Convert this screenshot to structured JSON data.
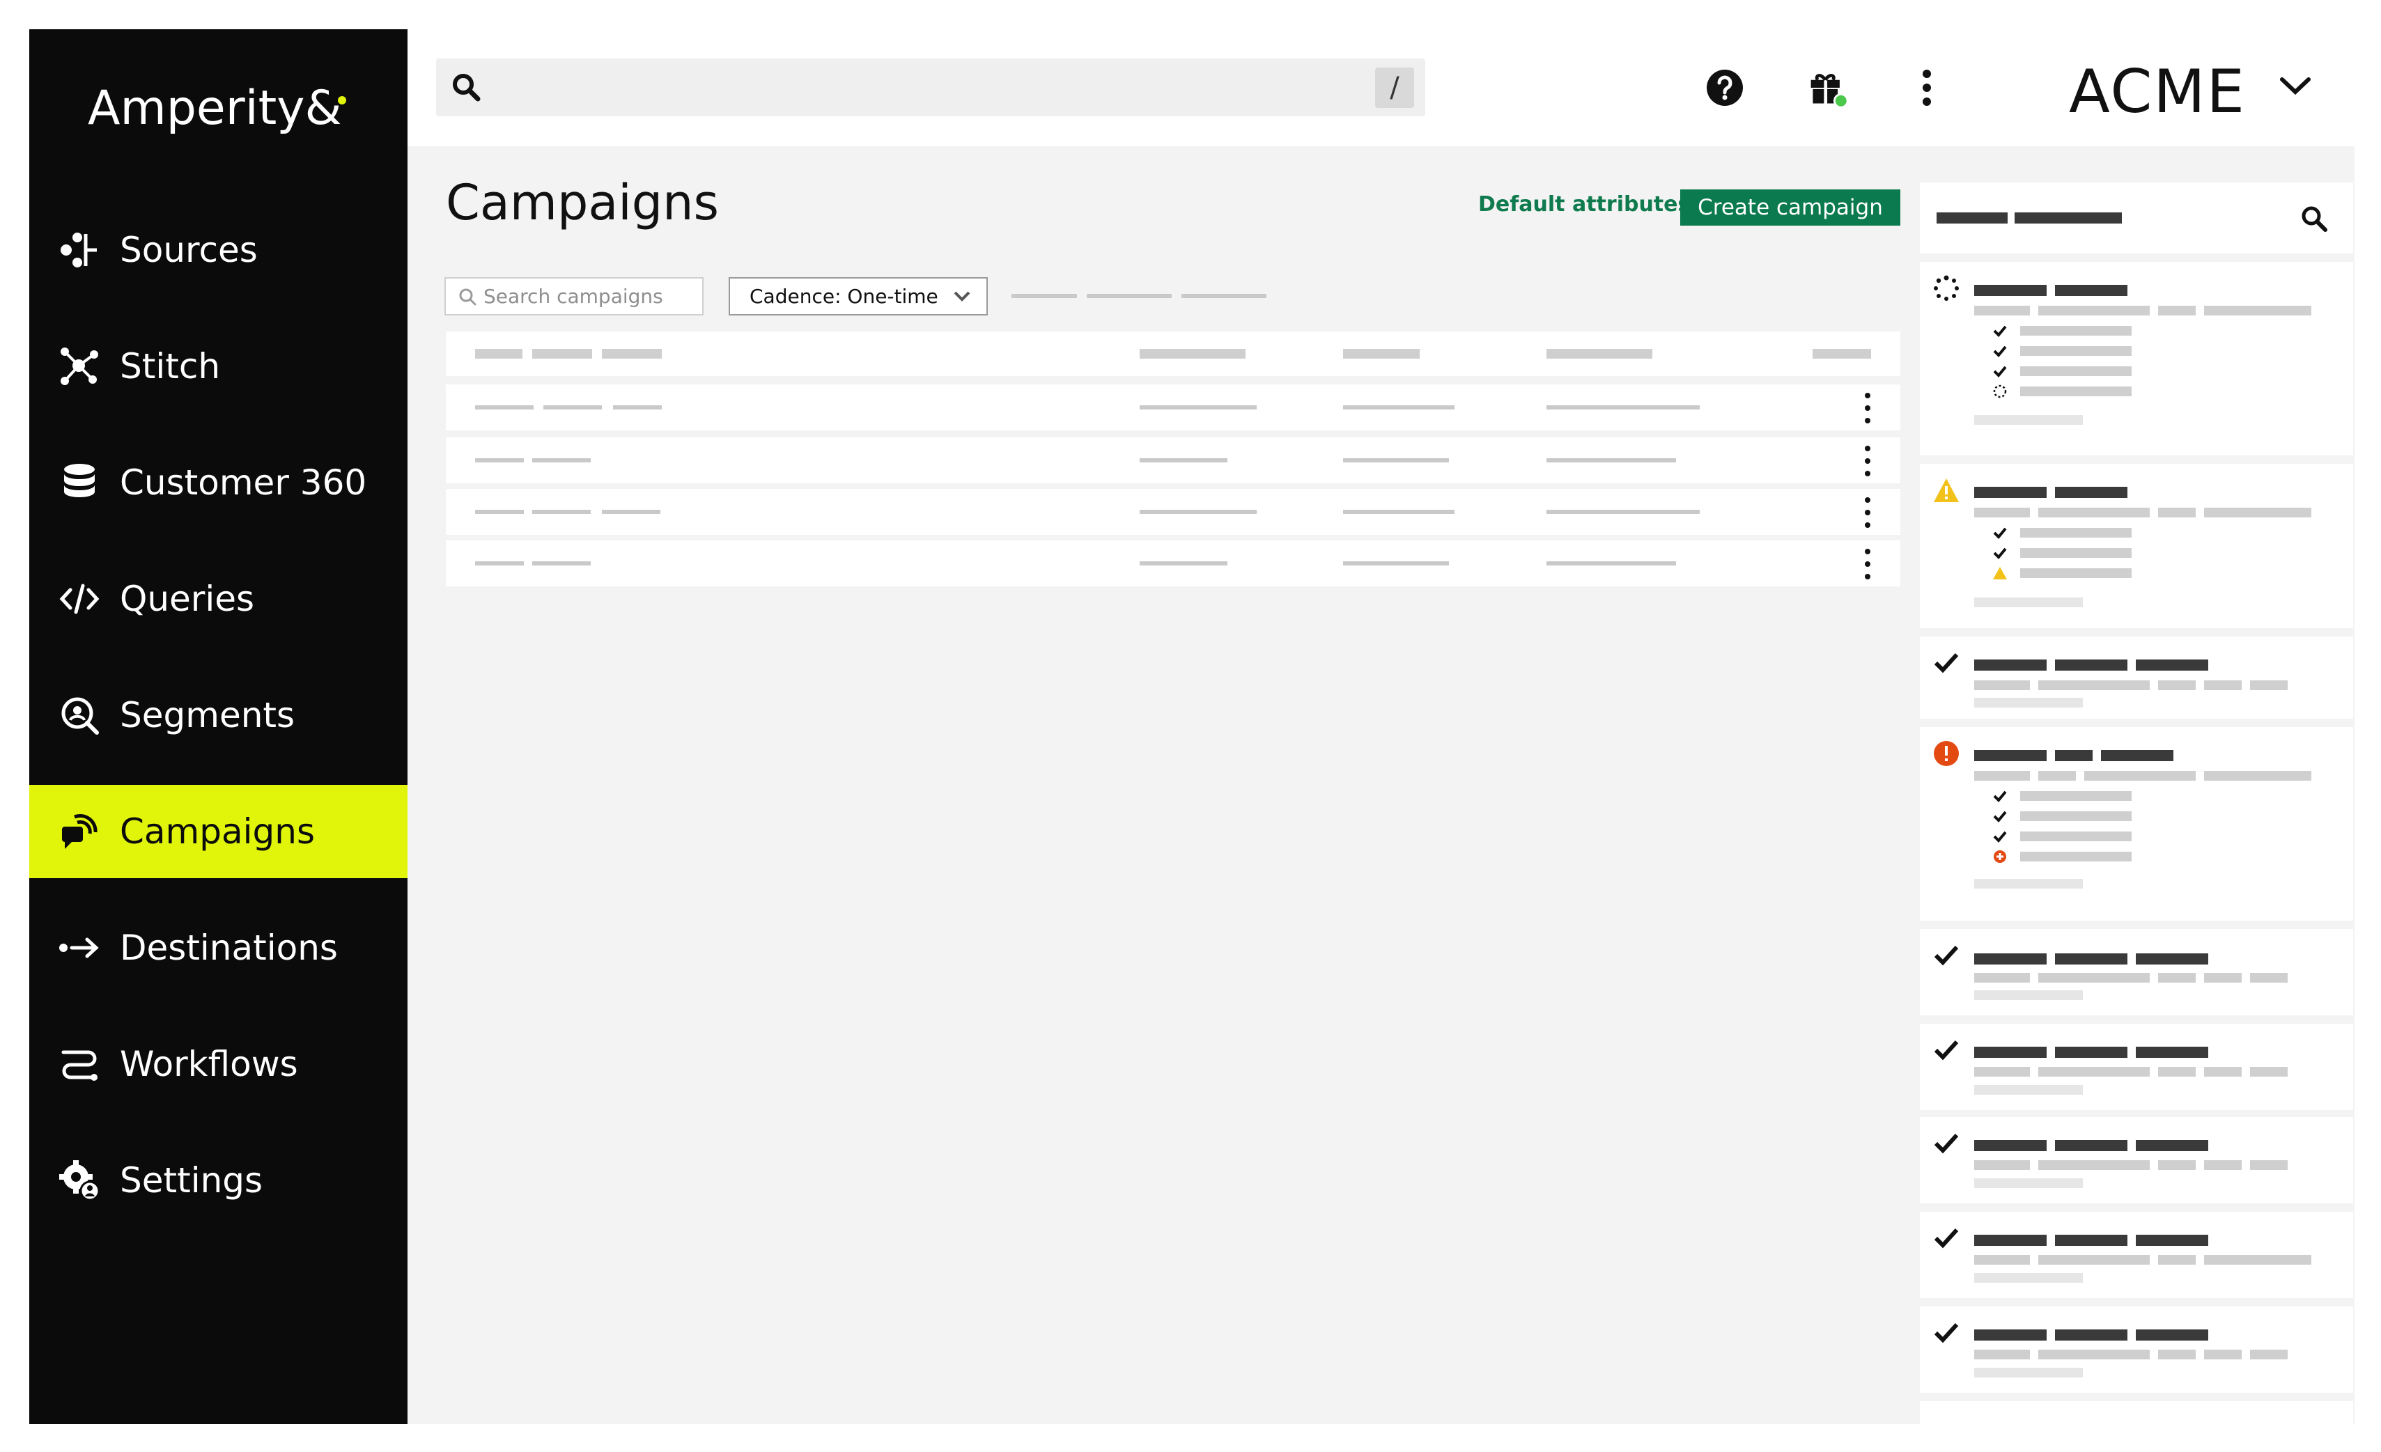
{
  "app": {
    "logo_text": "Amperity",
    "logo_mark": "&",
    "tenant_name": "ACME",
    "colors": {
      "accent": "#e0f50a",
      "primary_button": "#0b7a4f",
      "sidebar_bg": "#0b0b0b",
      "warning": "#f2c21b",
      "error": "#e34a12"
    }
  },
  "sidebar": {
    "items": [
      {
        "label": "Sources",
        "icon": "sources-icon",
        "active": false
      },
      {
        "label": "Stitch",
        "icon": "stitch-icon",
        "active": false
      },
      {
        "label": "Customer 360",
        "icon": "database-icon",
        "active": false
      },
      {
        "label": "Queries",
        "icon": "code-icon",
        "active": false
      },
      {
        "label": "Segments",
        "icon": "segments-icon",
        "active": false
      },
      {
        "label": "Campaigns",
        "icon": "campaigns-icon",
        "active": true
      },
      {
        "label": "Destinations",
        "icon": "destinations-icon",
        "active": false
      },
      {
        "label": "Workflows",
        "icon": "workflows-icon",
        "active": false
      },
      {
        "label": "Settings",
        "icon": "settings-icon",
        "active": false
      }
    ]
  },
  "topbar": {
    "search_shortcut": "/",
    "icons": [
      "search-icon",
      "help-icon",
      "gift-icon",
      "more-vertical-icon",
      "chevron-down-icon"
    ]
  },
  "main": {
    "title": "Campaigns",
    "default_attributes_link": "Default attributes",
    "create_button": "Create campaign",
    "search_placeholder": "Search campaigns",
    "cadence_filter": "Cadence: One-time"
  },
  "right_panel": {
    "card_statuses": [
      "in-progress",
      "warning",
      "success",
      "error",
      "success",
      "success",
      "success",
      "success",
      "success"
    ]
  }
}
